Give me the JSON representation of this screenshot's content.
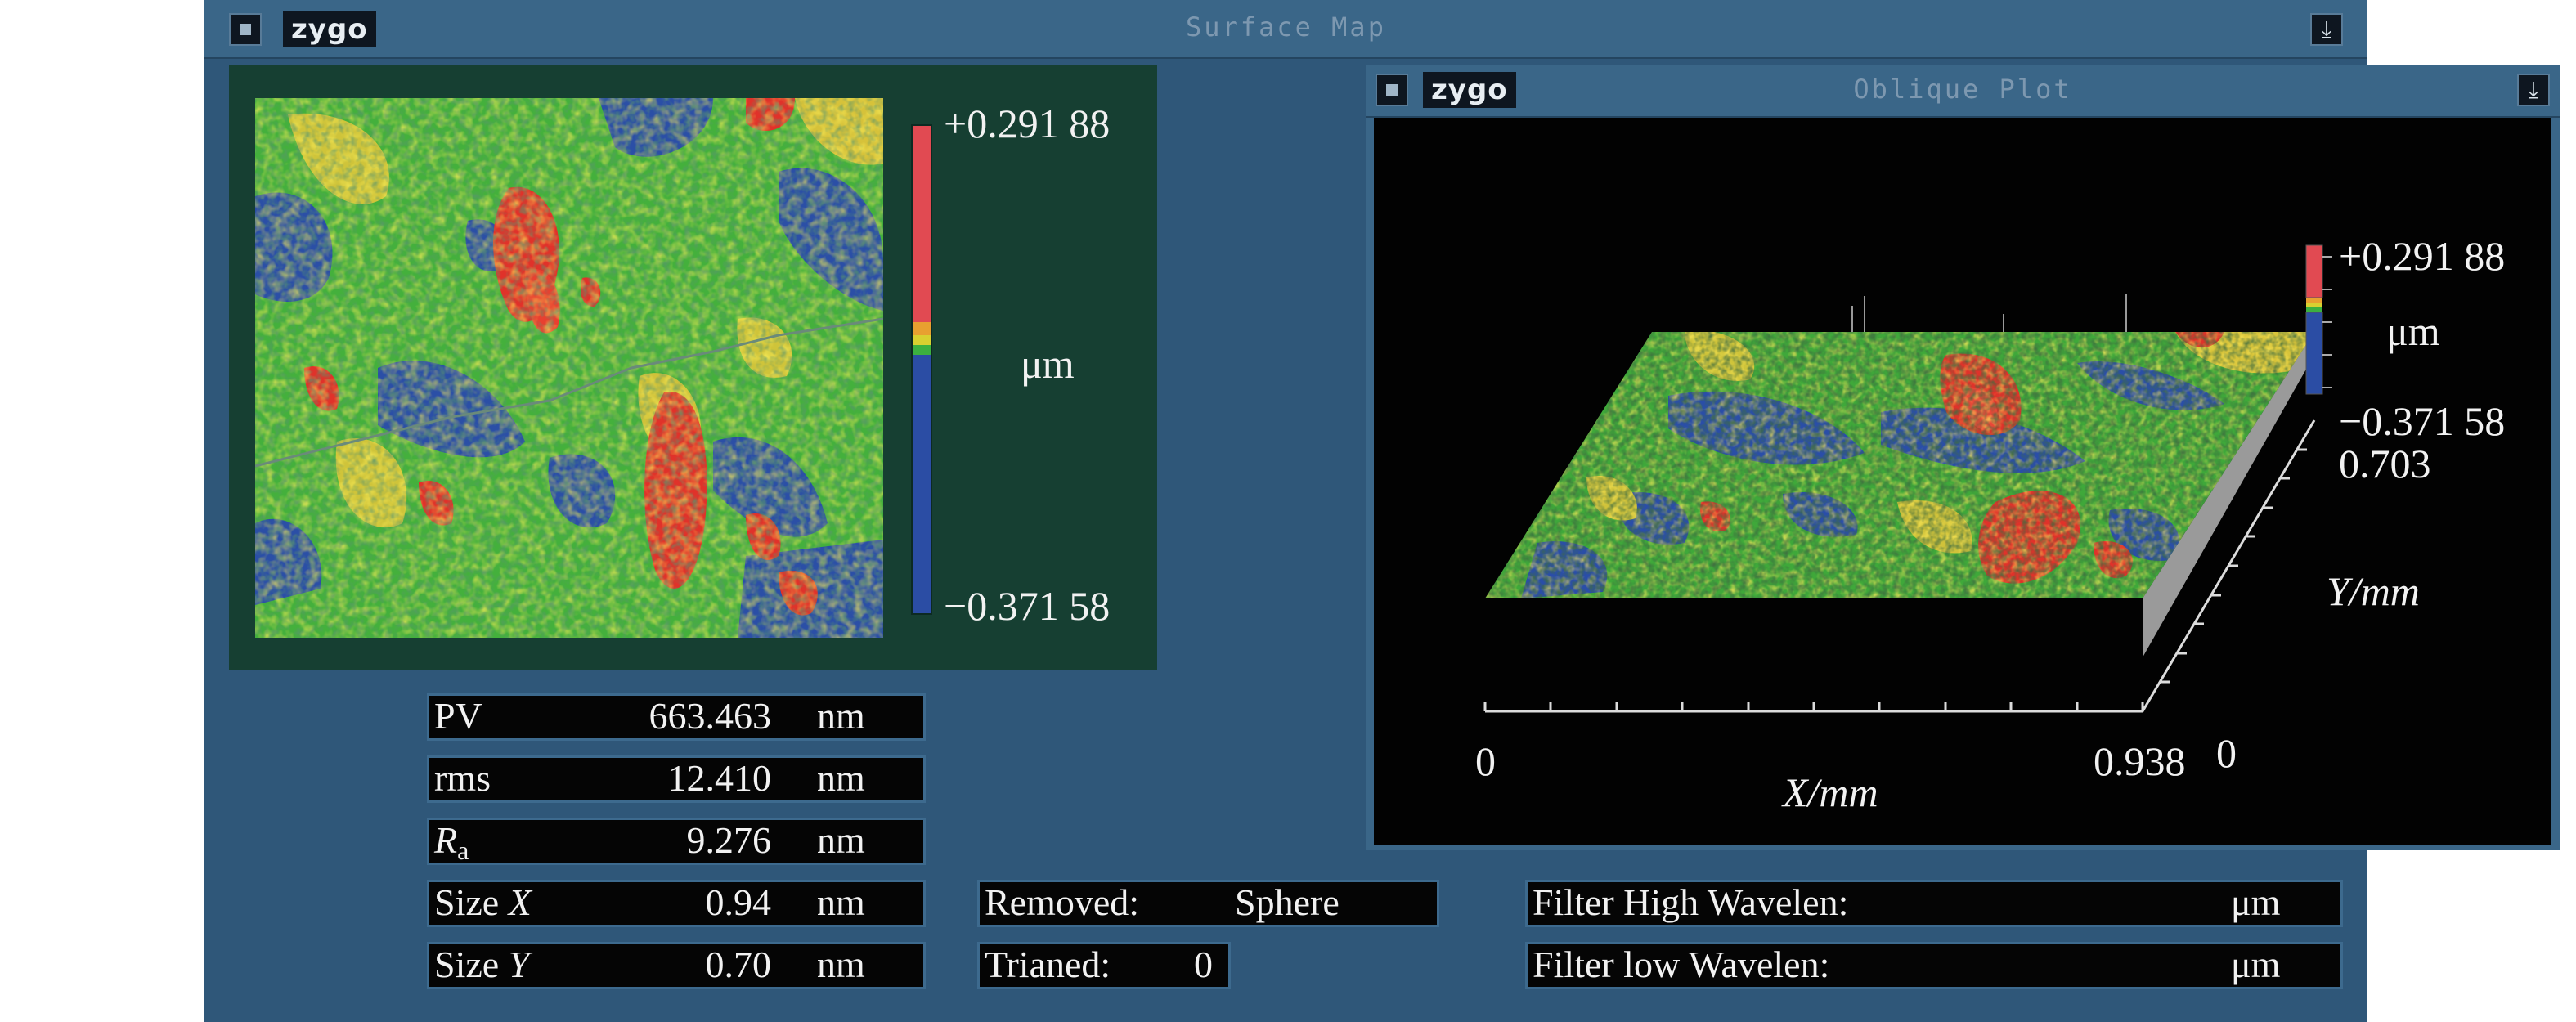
{
  "main_window": {
    "logo": "zygo",
    "title": "Surface Map",
    "close_glyph": "▪",
    "arrow_glyph": "⤓"
  },
  "surface_map": {
    "scale_max": "+0.291 88",
    "scale_unit": "μm",
    "scale_min": "−0.371 58"
  },
  "oblique_plot": {
    "logo": "zygo",
    "title": "Oblique Plot",
    "scale_max": "+0.291 88",
    "scale_unit": "μm",
    "scale_min": "−0.371 58",
    "y_max": "0.703",
    "y_label": "Y/mm",
    "y_min": "0",
    "x_min": "0",
    "x_max": "0.938",
    "x_label": "X/mm"
  },
  "stats": [
    {
      "label": "PV",
      "value": "663.463",
      "unit": "nm"
    },
    {
      "label": "rms",
      "value": "12.410",
      "unit": "nm"
    },
    {
      "label": "R",
      "label_sub": "a",
      "value": "9.276",
      "unit": "nm"
    },
    {
      "label": "Size ",
      "label_italic": "X",
      "value": "0.94",
      "unit": "nm"
    },
    {
      "label": "Size ",
      "label_italic": "Y",
      "value": "0.70",
      "unit": "nm"
    }
  ],
  "removed": {
    "label": "Removed:",
    "value": "Sphere"
  },
  "trianed": {
    "label": "Trianed:",
    "value": "0"
  },
  "filters": [
    {
      "label": "Filter High Wavelen:",
      "unit": "μm"
    },
    {
      "label": "Filter low Wavelen:",
      "unit": "μm"
    }
  ],
  "colors": {
    "window_bg": "#2f5779",
    "panel_bg": "#163f32",
    "map_green": "#3fae3a",
    "map_red": "#e0322a",
    "map_blue": "#2a4ea8",
    "map_yellow": "#d8c838"
  }
}
